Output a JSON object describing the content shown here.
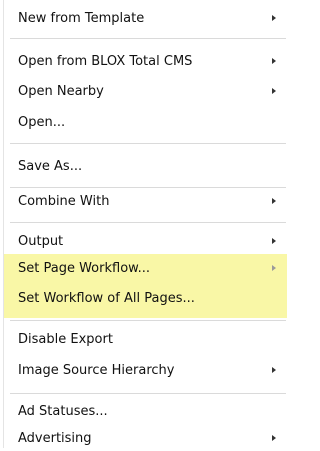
{
  "menu": {
    "items": [
      {
        "label": "New from Template",
        "submenu": true
      },
      {
        "label": "Open from BLOX Total CMS",
        "submenu": true
      },
      {
        "label": "Open Nearby",
        "submenu": true
      },
      {
        "label": "Open...",
        "submenu": false
      },
      {
        "label": "Save As...",
        "submenu": false
      },
      {
        "label": "Combine With",
        "submenu": true
      },
      {
        "label": "Output",
        "submenu": true
      },
      {
        "label": "Set Page Workflow...",
        "submenu": true,
        "highlighted": true
      },
      {
        "label": "Set Workflow of All Pages...",
        "submenu": false,
        "highlighted": true
      },
      {
        "label": "Disable Export",
        "submenu": false
      },
      {
        "label": "Image Source Hierarchy",
        "submenu": true
      },
      {
        "label": "Ad Statuses...",
        "submenu": false
      },
      {
        "label": "Advertising",
        "submenu": true
      }
    ],
    "highlight_color": "#f9f7a6"
  }
}
